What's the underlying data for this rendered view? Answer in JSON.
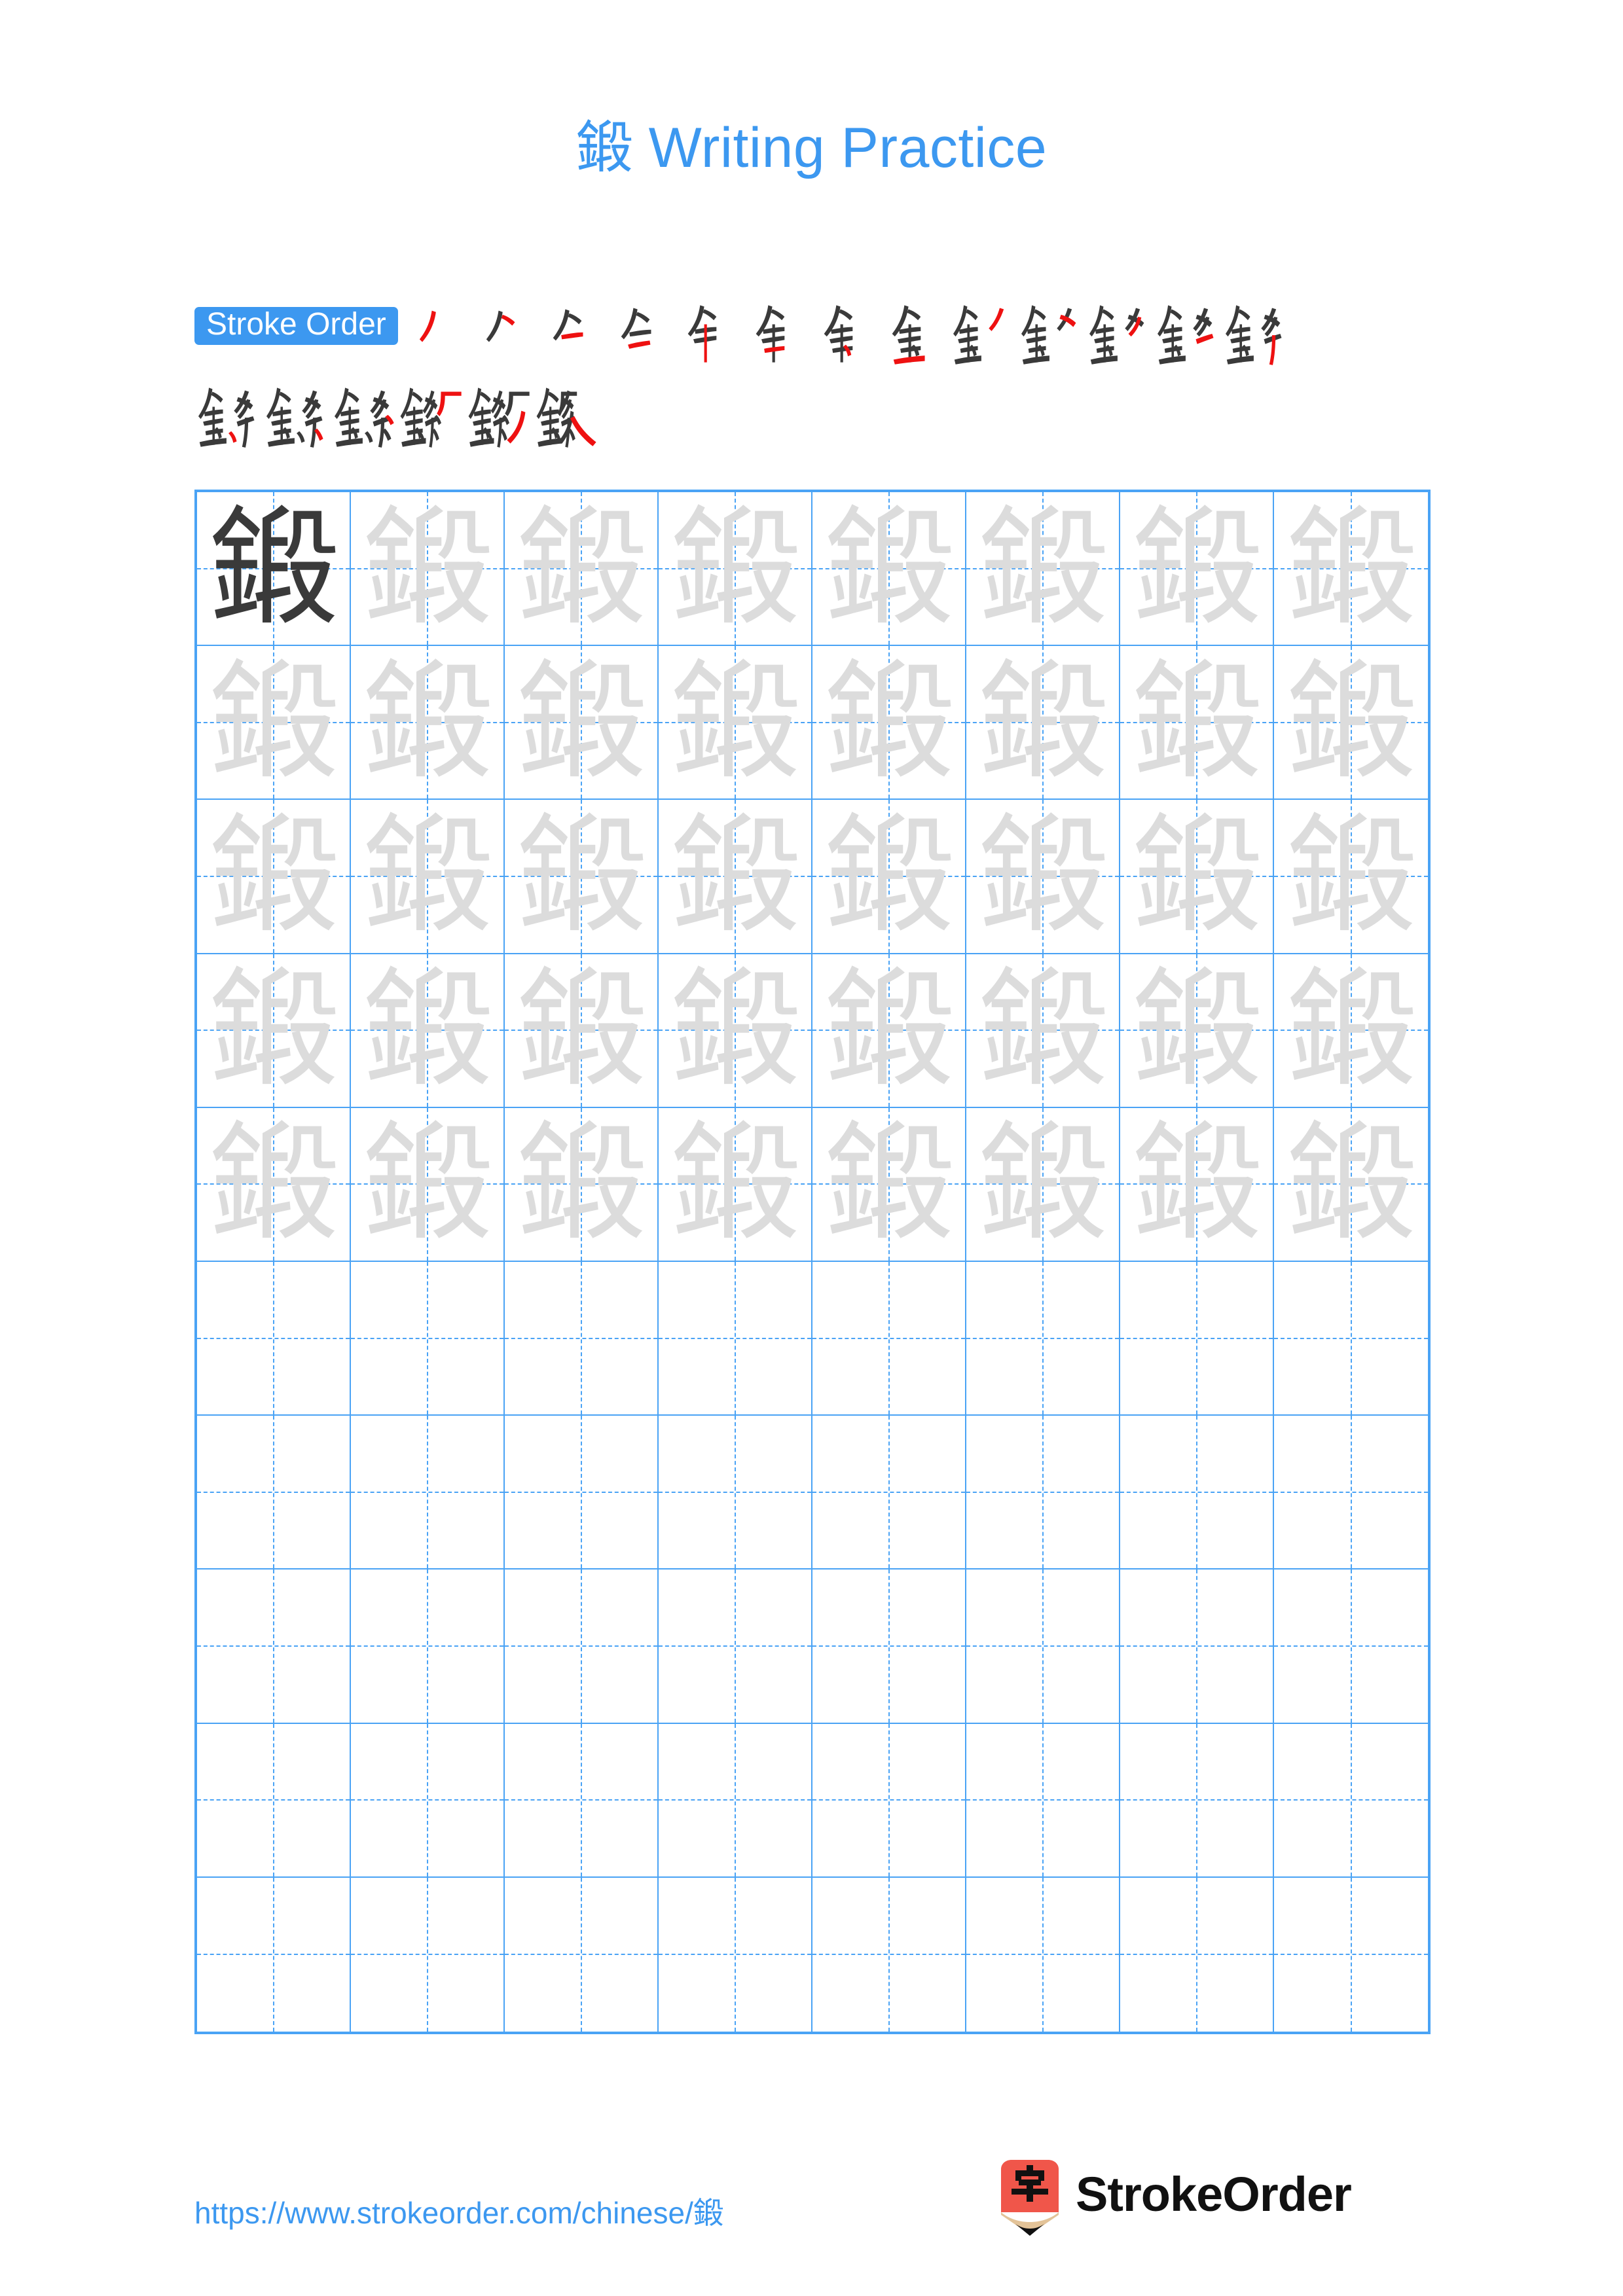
{
  "page": {
    "title_char": "鍛",
    "title_suffix": " Writing Practice",
    "character": "鍛",
    "accent_color": "#3C98F0",
    "grid_line_color": "#4AA3F5",
    "trace_color": "#DCDCDC",
    "solid_char_color": "#3A3A3A",
    "stroke_new_color": "#EE1111",
    "stroke_old_color": "#3A3A3A"
  },
  "stroke_order": {
    "badge_label": "Stroke Order",
    "total_strokes": 19,
    "rows": [
      {
        "count": 13,
        "start_index": 1
      },
      {
        "count": 6,
        "start_index": 14
      }
    ],
    "steps": [
      {
        "index": 1,
        "partial": "丿"
      },
      {
        "index": 2,
        "partial": "𠂉"
      },
      {
        "index": 3,
        "partial": "亼"
      },
      {
        "index": 4,
        "partial": "亽"
      },
      {
        "index": 5,
        "partial": "仐"
      },
      {
        "index": 6,
        "partial": "全"
      },
      {
        "index": 7,
        "partial": "余"
      },
      {
        "index": 8,
        "partial": "金"
      },
      {
        "index": 9,
        "partial": "釒丿"
      },
      {
        "index": 10,
        "partial": "釒𠂉"
      },
      {
        "index": 11,
        "partial": "釒彡"
      },
      {
        "index": 12,
        "partial": "釤"
      },
      {
        "index": 13,
        "partial": "釨"
      },
      {
        "index": 14,
        "partial": "鈐"
      },
      {
        "index": 15,
        "partial": "鈫"
      },
      {
        "index": 16,
        "partial": "鈸"
      },
      {
        "index": 17,
        "partial": "鍜"
      },
      {
        "index": 18,
        "partial": "鍛"
      },
      {
        "index": 19,
        "partial": "鍛"
      }
    ]
  },
  "practice_grid": {
    "columns": 8,
    "rows": 10,
    "filled_rows": 5,
    "empty_rows": 5,
    "first_cell_is_solid": true,
    "cell_character": "鍛"
  },
  "footer": {
    "url": "https://www.strokeorder.com/chinese/鍛",
    "brand_name": "StrokeOrder",
    "logo_char": "字",
    "logo_body_color": "#F0564A",
    "logo_wood_color": "#E3C398",
    "logo_tip_color": "#111111"
  }
}
